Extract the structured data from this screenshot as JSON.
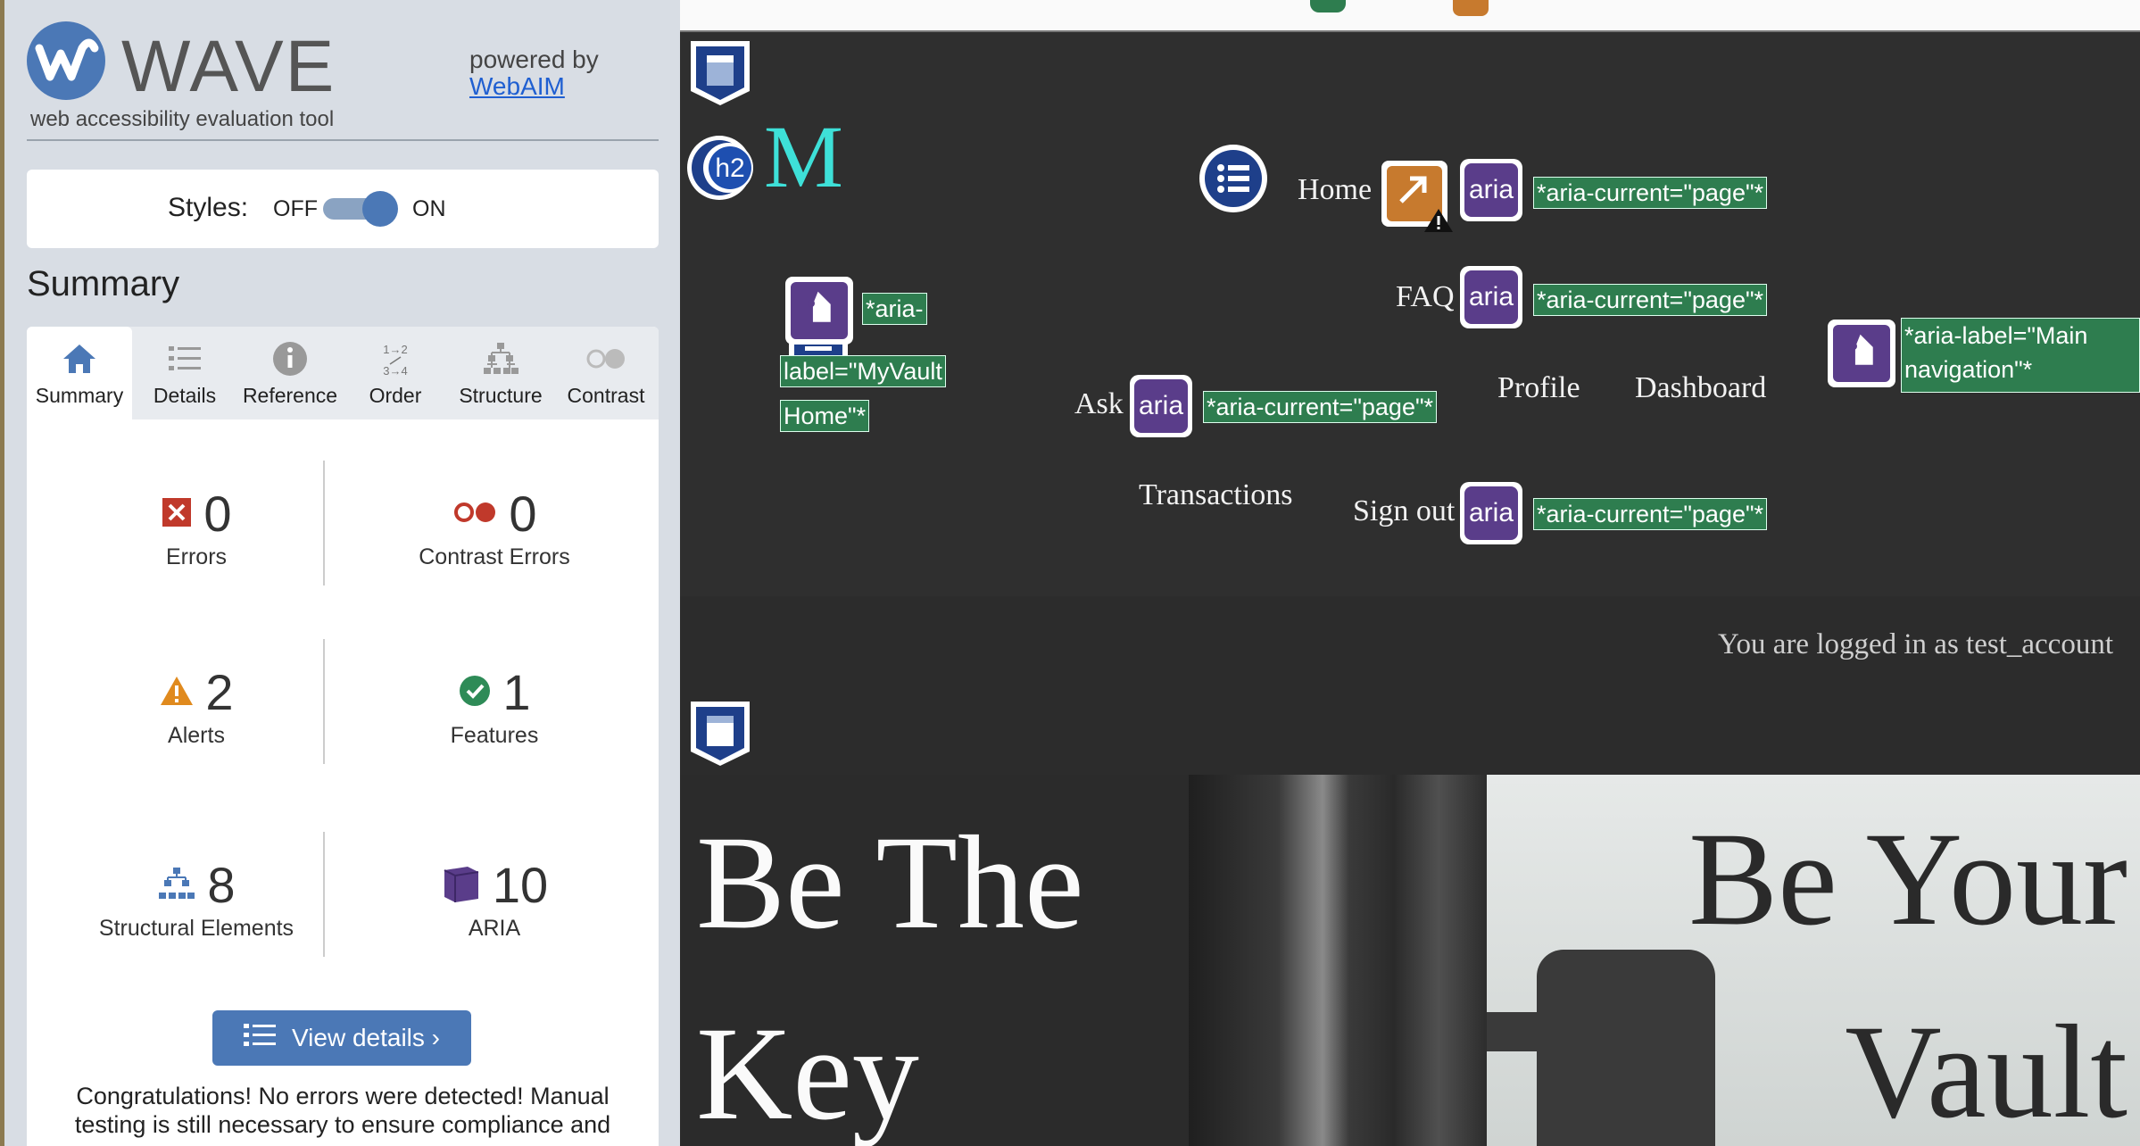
{
  "wave": {
    "logo_text": "WAVE",
    "tagline": "web accessibility evaluation tool",
    "powered_by": "powered by",
    "webaim_link": "WebAIM",
    "styles_label": "Styles:",
    "styles_off": "OFF",
    "styles_on": "ON",
    "styles_state": "on",
    "summary_heading": "Summary",
    "tabs": [
      {
        "label": "Summary",
        "icon": "home-icon",
        "active": true
      },
      {
        "label": "Details",
        "icon": "list-icon",
        "active": false
      },
      {
        "label": "Reference",
        "icon": "info-icon",
        "active": false
      },
      {
        "label": "Order",
        "icon": "order-icon",
        "active": false
      },
      {
        "label": "Structure",
        "icon": "structure-icon",
        "active": false
      },
      {
        "label": "Contrast",
        "icon": "contrast-icon",
        "active": false
      }
    ],
    "order_icon_text": {
      "top": "1→2",
      "bottom": "3→4"
    },
    "stats": {
      "errors": {
        "count": "0",
        "label": "Errors"
      },
      "contrast_errors": {
        "count": "0",
        "label": "Contrast Errors"
      },
      "alerts": {
        "count": "2",
        "label": "Alerts"
      },
      "features": {
        "count": "1",
        "label": "Features"
      },
      "structural": {
        "count": "8",
        "label": "Structural Elements"
      },
      "aria": {
        "count": "10",
        "label": "ARIA"
      }
    },
    "view_details_label": "View details ›",
    "congrats_text": "Congratulations! No errors were detected! Manual testing is still necessary to ensure compliance and"
  },
  "site": {
    "heading_icon_label": "h2",
    "logo_letter": "M",
    "aria_chip_label": "aria",
    "aria_current_tag": "*aria-current=\"page\"*",
    "brand_tag_line1": "*aria-",
    "brand_tag_line2": "label=\"MyVault",
    "brand_tag_line3": "Home\"*",
    "nav_tag_line1": "*aria-label=\"Main",
    "nav_tag_line2": "navigation\"*",
    "nav": {
      "home": "Home",
      "faq": "FAQ",
      "ask": "Ask",
      "profile": "Profile",
      "dashboard": "Dashboard",
      "transactions": "Transactions",
      "sign_out": "Sign out"
    },
    "logged_in_text": "You are logged in as test_account",
    "hero_left_line1": "Be The",
    "hero_left_line2": "Key",
    "hero_right_line1": "Be Your",
    "hero_right_line2": "Vault"
  },
  "colors": {
    "wave_blue": "#4b78b6",
    "error_red": "#c0392b",
    "alert_orange": "#e08a1e",
    "feature_green": "#2e8b57",
    "aria_purple": "#5a3d8a",
    "tag_green": "#2e7d4f"
  }
}
